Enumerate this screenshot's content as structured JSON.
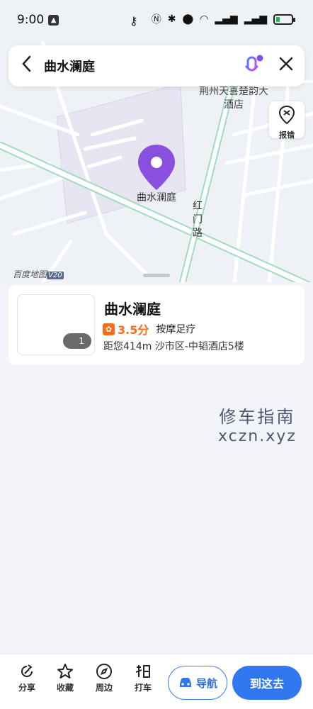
{
  "status_bar": {
    "time": "9:00"
  },
  "search": {
    "query": "曲水澜庭",
    "back_icon": "back-arrow-icon",
    "mic_icon": "voice-mic-icon",
    "close_icon": "close-icon"
  },
  "map": {
    "poi_hotel": "荆州天喜楚韵大酒店",
    "report_label": "报错",
    "pin_label": "曲水澜庭",
    "road_name": "红门路",
    "brand": "百度地图",
    "brand_version": "V20"
  },
  "place": {
    "name": "曲水澜庭",
    "photo_count": "1",
    "rating": "3.5分",
    "category": "按摩足疗",
    "address": "距您414m  沙市区-中韬酒店5楼"
  },
  "watermark": {
    "line1": "修车指南",
    "line2": "xczn.xyz"
  },
  "actions": [
    {
      "label": "分享",
      "icon": "share-icon"
    },
    {
      "label": "收藏",
      "icon": "star-icon"
    },
    {
      "label": "周边",
      "icon": "compass-icon"
    },
    {
      "label": "打车",
      "icon": "taxi-icon"
    }
  ],
  "nav_button": "导航",
  "go_button": "到这去",
  "colors": {
    "accent": "#3178f0",
    "rating": "#ff6a1a",
    "pin": "#8b4fe0"
  }
}
